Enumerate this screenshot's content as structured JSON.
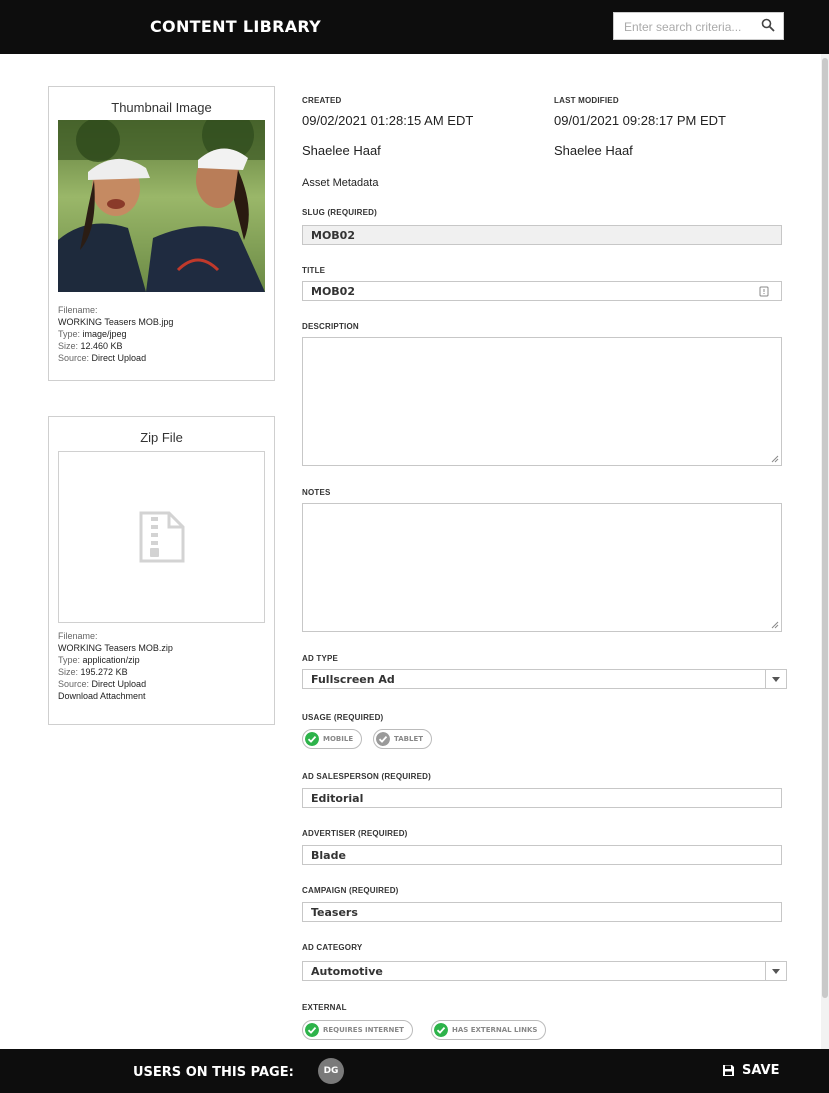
{
  "header": {
    "title": "CONTENT LIBRARY",
    "search_placeholder": "Enter search criteria..."
  },
  "thumbnail": {
    "title": "Thumbnail Image",
    "filename_label": "Filename:",
    "filename": "WORKING Teasers MOB.jpg",
    "type_label": "Type:",
    "type": "image/jpeg",
    "size_label": "Size:",
    "size": "12.460 KB",
    "source_label": "Source:",
    "source": "Direct Upload"
  },
  "zip": {
    "title": "Zip File",
    "filename_label": "Filename:",
    "filename": "WORKING Teasers MOB.zip",
    "type_label": "Type:",
    "type": "application/zip",
    "size_label": "Size:",
    "size": "195.272 KB",
    "source_label": "Source:",
    "source": "Direct Upload",
    "download_label": "Download Attachment"
  },
  "info": {
    "created_label": "CREATED",
    "created_date": "09/02/2021 01:28:15 AM EDT",
    "created_by": "Shaelee Haaf",
    "modified_label": "LAST MODIFIED",
    "modified_date": "09/01/2021 09:28:17 PM EDT",
    "modified_by": "Shaelee Haaf",
    "section_title": "Asset Metadata"
  },
  "form": {
    "slug_label": "SLUG (REQUIRED)",
    "slug_value": "MOB02",
    "title_label": "TITLE",
    "title_value": "MOB02",
    "description_label": "DESCRIPTION",
    "notes_label": "NOTES",
    "ad_type_label": "AD TYPE",
    "ad_type_value": "Fullscreen Ad",
    "usage_label": "USAGE (REQUIRED)",
    "usage_options": [
      {
        "label": "MOBILE",
        "checked": true
      },
      {
        "label": "TABLET",
        "checked": false
      }
    ],
    "salesperson_label": "AD SALESPERSON (REQUIRED)",
    "salesperson_value": "Editorial",
    "advertiser_label": "ADVERTISER (REQUIRED)",
    "advertiser_value": "Blade",
    "campaign_label": "CAMPAIGN (REQUIRED)",
    "campaign_value": "Teasers",
    "ad_category_label": "AD CATEGORY",
    "ad_category_value": "Automotive",
    "external_label": "EXTERNAL",
    "external_options": [
      {
        "label": "REQUIRES INTERNET",
        "checked": true
      },
      {
        "label": "HAS EXTERNAL LINKS",
        "checked": true
      }
    ]
  },
  "footer": {
    "users_label": "USERS ON THIS PAGE:",
    "avatar_initials": "DG",
    "save_label": "SAVE"
  },
  "colors": {
    "bar": "#0d0d0d",
    "check_green": "#2db34a",
    "check_grey": "#9a9a9a"
  }
}
